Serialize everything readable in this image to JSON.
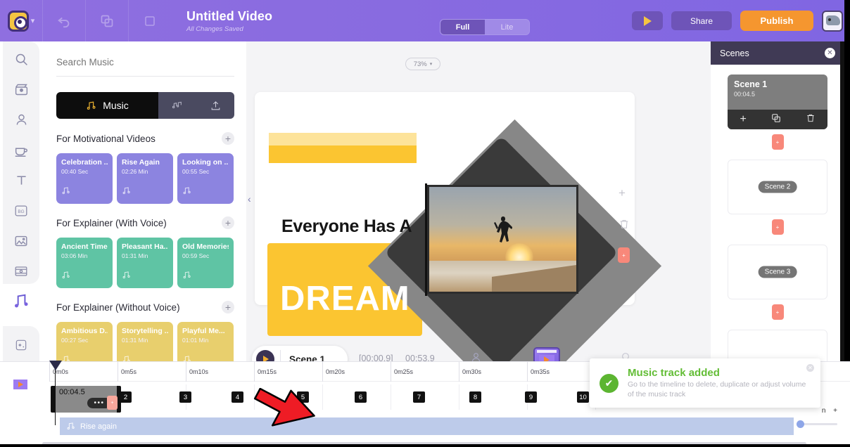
{
  "header": {
    "logo_icon": "owl-logo-icon",
    "logo_chevron": "▾",
    "undo_icon": "undo-icon",
    "duplicate_icon": "duplicate-icon",
    "title": "Untitled Video",
    "subtitle": "All Changes Saved",
    "mode_toggle": {
      "full": "Full",
      "lite": "Lite",
      "selected": "Full"
    },
    "play_icon": "play-icon",
    "share_label": "Share",
    "publish_label": "Publish",
    "avatar_icon": "user-avatar-icon",
    "brand_purple": "#8a6ce0",
    "publish_orange": "#f5962f"
  },
  "rail": {
    "items": [
      {
        "name": "search",
        "icon": "search-icon"
      },
      {
        "name": "templates",
        "icon": "clapperboard-icon"
      },
      {
        "name": "characters",
        "icon": "person-icon"
      },
      {
        "name": "props",
        "icon": "coffee-cup-icon"
      },
      {
        "name": "text",
        "icon": "text-icon"
      },
      {
        "name": "background",
        "icon": "bg-icon",
        "label": "BG"
      },
      {
        "name": "images",
        "icon": "image-icon"
      },
      {
        "name": "video",
        "icon": "film-strip-icon"
      },
      {
        "name": "music",
        "icon": "music-note-icon",
        "selected": true
      },
      {
        "name": "effects",
        "icon": "sparkle-icon"
      },
      {
        "name": "upload",
        "icon": "upload-icon"
      }
    ],
    "video_button_icon": "video-play-icon",
    "mic_button_icon": "microphone-icon"
  },
  "music_panel": {
    "search_placeholder": "Search Music",
    "search_value": "",
    "tabs": [
      {
        "label": "Music",
        "icon": "music-note-icon",
        "selected": true
      },
      {
        "label": "",
        "icon": "sound-effects-icon",
        "selected": false
      },
      {
        "label": "",
        "icon": "upload-icon",
        "selected": false
      }
    ],
    "sections": [
      {
        "title": "For Motivational Videos",
        "add_icon": "plus-icon",
        "color": "#8c84e0",
        "tracks": [
          {
            "name": "Celebration ...",
            "duration": "00:40 Sec"
          },
          {
            "name": "Rise Again",
            "duration": "02:26 Min"
          },
          {
            "name": "Looking on ...",
            "duration": "00:55 Sec"
          }
        ]
      },
      {
        "title": "For Explainer (With Voice)",
        "add_icon": "plus-icon",
        "color": "#5fc4a4",
        "tracks": [
          {
            "name": "Ancient Times",
            "duration": "03:06 Min"
          },
          {
            "name": "Pleasant Ha...",
            "duration": "01:31 Min"
          },
          {
            "name": "Old Memories",
            "duration": "00:59 Sec"
          }
        ]
      },
      {
        "title": "For Explainer (Without Voice)",
        "add_icon": "plus-icon",
        "color": "#e8cf6d",
        "tracks": [
          {
            "name": "Ambitious D...",
            "duration": "00:27 Sec"
          },
          {
            "name": "Storytelling ...",
            "duration": "01:31 Min"
          },
          {
            "name": "Playful Me...",
            "duration": "01:01 Min"
          }
        ]
      }
    ]
  },
  "stage": {
    "zoom_level": "73%",
    "zoom_caret": "▾",
    "collapse_icon": "chevron-left-icon",
    "slide": {
      "headline": "Everyone Has A",
      "word": "DREAM",
      "photo_alt": "person jumping at sunset beach"
    },
    "side_tools": [
      {
        "name": "add",
        "icon": "plus-icon"
      },
      {
        "name": "delete",
        "icon": "trash-icon"
      },
      {
        "name": "add-scene",
        "icon": "add-scene-chip-icon"
      }
    ]
  },
  "scene_bar": {
    "play_icon": "play-icon",
    "scene_label": "Scene 1",
    "current_time": "[00:00.9]",
    "total_time": "00:53.9",
    "icons": [
      {
        "name": "character",
        "icon": "person-icon"
      },
      {
        "name": "video-clip",
        "icon": "video-play-icon"
      },
      {
        "name": "search",
        "icon": "search-icon"
      }
    ]
  },
  "scenes_panel": {
    "title": "Scenes",
    "close_icon": "close-icon",
    "scenes": [
      {
        "label": "Scene 1",
        "duration": "00:04.5",
        "active": true,
        "tools": [
          {
            "name": "add",
            "icon": "plus-icon"
          },
          {
            "name": "duplicate",
            "icon": "duplicate-icon"
          },
          {
            "name": "delete",
            "icon": "trash-icon"
          }
        ]
      },
      {
        "label": "Scene 2",
        "duration": "",
        "active": false,
        "tools": []
      },
      {
        "label": "Scene 3",
        "duration": "",
        "active": false,
        "tools": []
      }
    ],
    "add_between_icon": "add-scene-chip-icon"
  },
  "timeline": {
    "ruler_ticks": [
      "0m0s",
      "0m5s",
      "0m10s",
      "0m15s",
      "0m20s",
      "0m25s",
      "0m30s",
      "0m35s"
    ],
    "scene_markers": [
      "2",
      "3",
      "4",
      "5",
      "6",
      "7",
      "8",
      "9",
      "10"
    ],
    "clip": {
      "duration": "00:04.5",
      "menu_icon": "more-dots-icon",
      "dots": "•••"
    },
    "music_track": {
      "name": "Rise again",
      "icon": "music-note-icon"
    },
    "corner_label": "n  +"
  },
  "toast": {
    "title": "Music track added",
    "message": "Go to the timeline to delete, duplicate or adjust volume of the music track",
    "check_icon": "check-circle-icon",
    "close_icon": "close-icon",
    "accent_green": "#63bd36"
  },
  "cursor": {
    "icon": "red-arrow-cursor"
  }
}
